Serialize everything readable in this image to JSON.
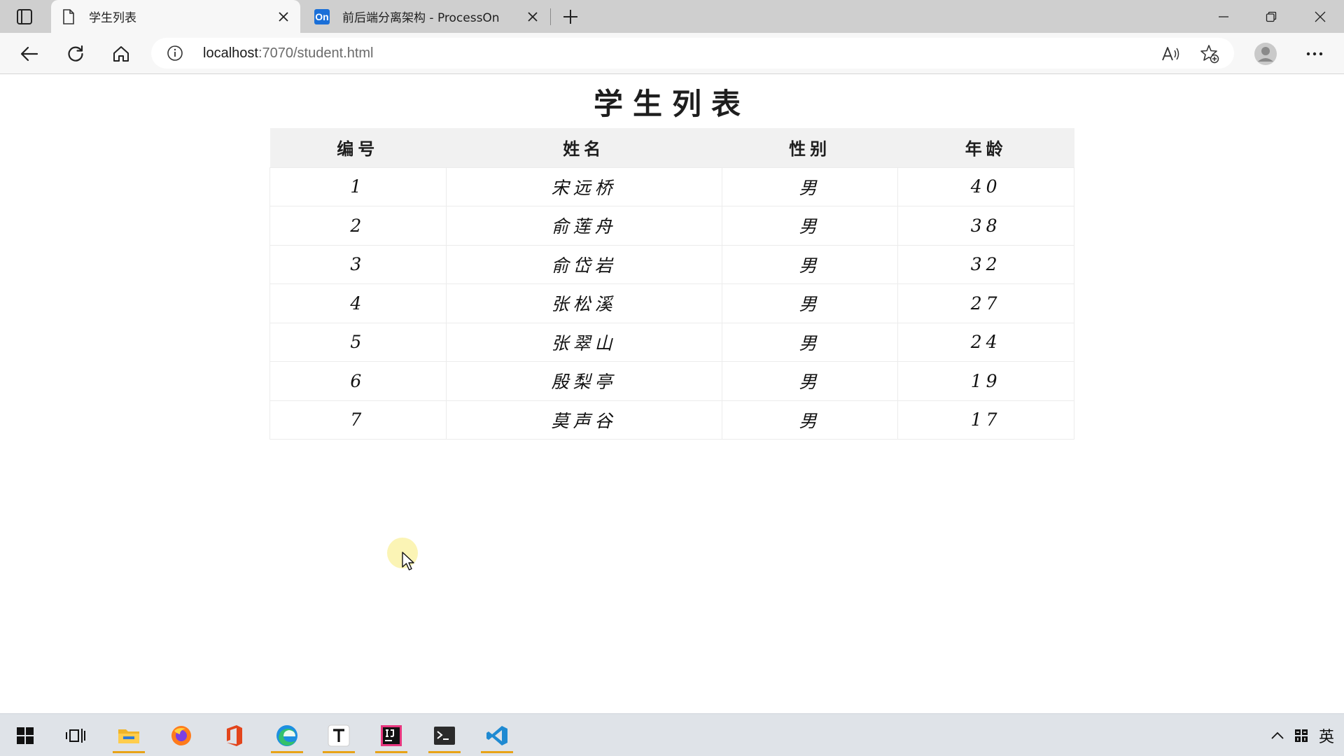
{
  "browser": {
    "tabs": [
      {
        "title": "学生列表",
        "active": true,
        "favicon": "page-icon"
      },
      {
        "title": "前后端分离架构 - ProcessOn",
        "active": false,
        "favicon": "processon-icon",
        "badge": "On"
      }
    ],
    "address": {
      "host": "localhost",
      "rest": ":7070/student.html"
    }
  },
  "page": {
    "title": "学生列表",
    "table": {
      "headers": [
        "编号",
        "姓名",
        "性别",
        "年龄"
      ],
      "rows": [
        [
          "1",
          "宋远桥",
          "男",
          "40"
        ],
        [
          "2",
          "俞莲舟",
          "男",
          "38"
        ],
        [
          "3",
          "俞岱岩",
          "男",
          "32"
        ],
        [
          "4",
          "张松溪",
          "男",
          "27"
        ],
        [
          "5",
          "张翠山",
          "男",
          "24"
        ],
        [
          "6",
          "殷梨亭",
          "男",
          "19"
        ],
        [
          "7",
          "莫声谷",
          "男",
          "17"
        ]
      ]
    }
  },
  "taskbar": {
    "apps": [
      "start-icon",
      "task-view-icon",
      "file-explorer-icon",
      "firefox-icon",
      "office-icon",
      "edge-icon",
      "typora-icon",
      "intellij-icon",
      "terminal-icon",
      "vscode-icon"
    ],
    "tray": {
      "ime_mode": "英"
    }
  },
  "colors": {
    "tabstrip": "#cfcfcf",
    "toolbar": "#f7f7f7",
    "table_header_bg": "#f1f1f1",
    "taskbar": "#dfe3e8",
    "running_indicator": "#e8a317",
    "processon_blue": "#1a6fd8"
  }
}
